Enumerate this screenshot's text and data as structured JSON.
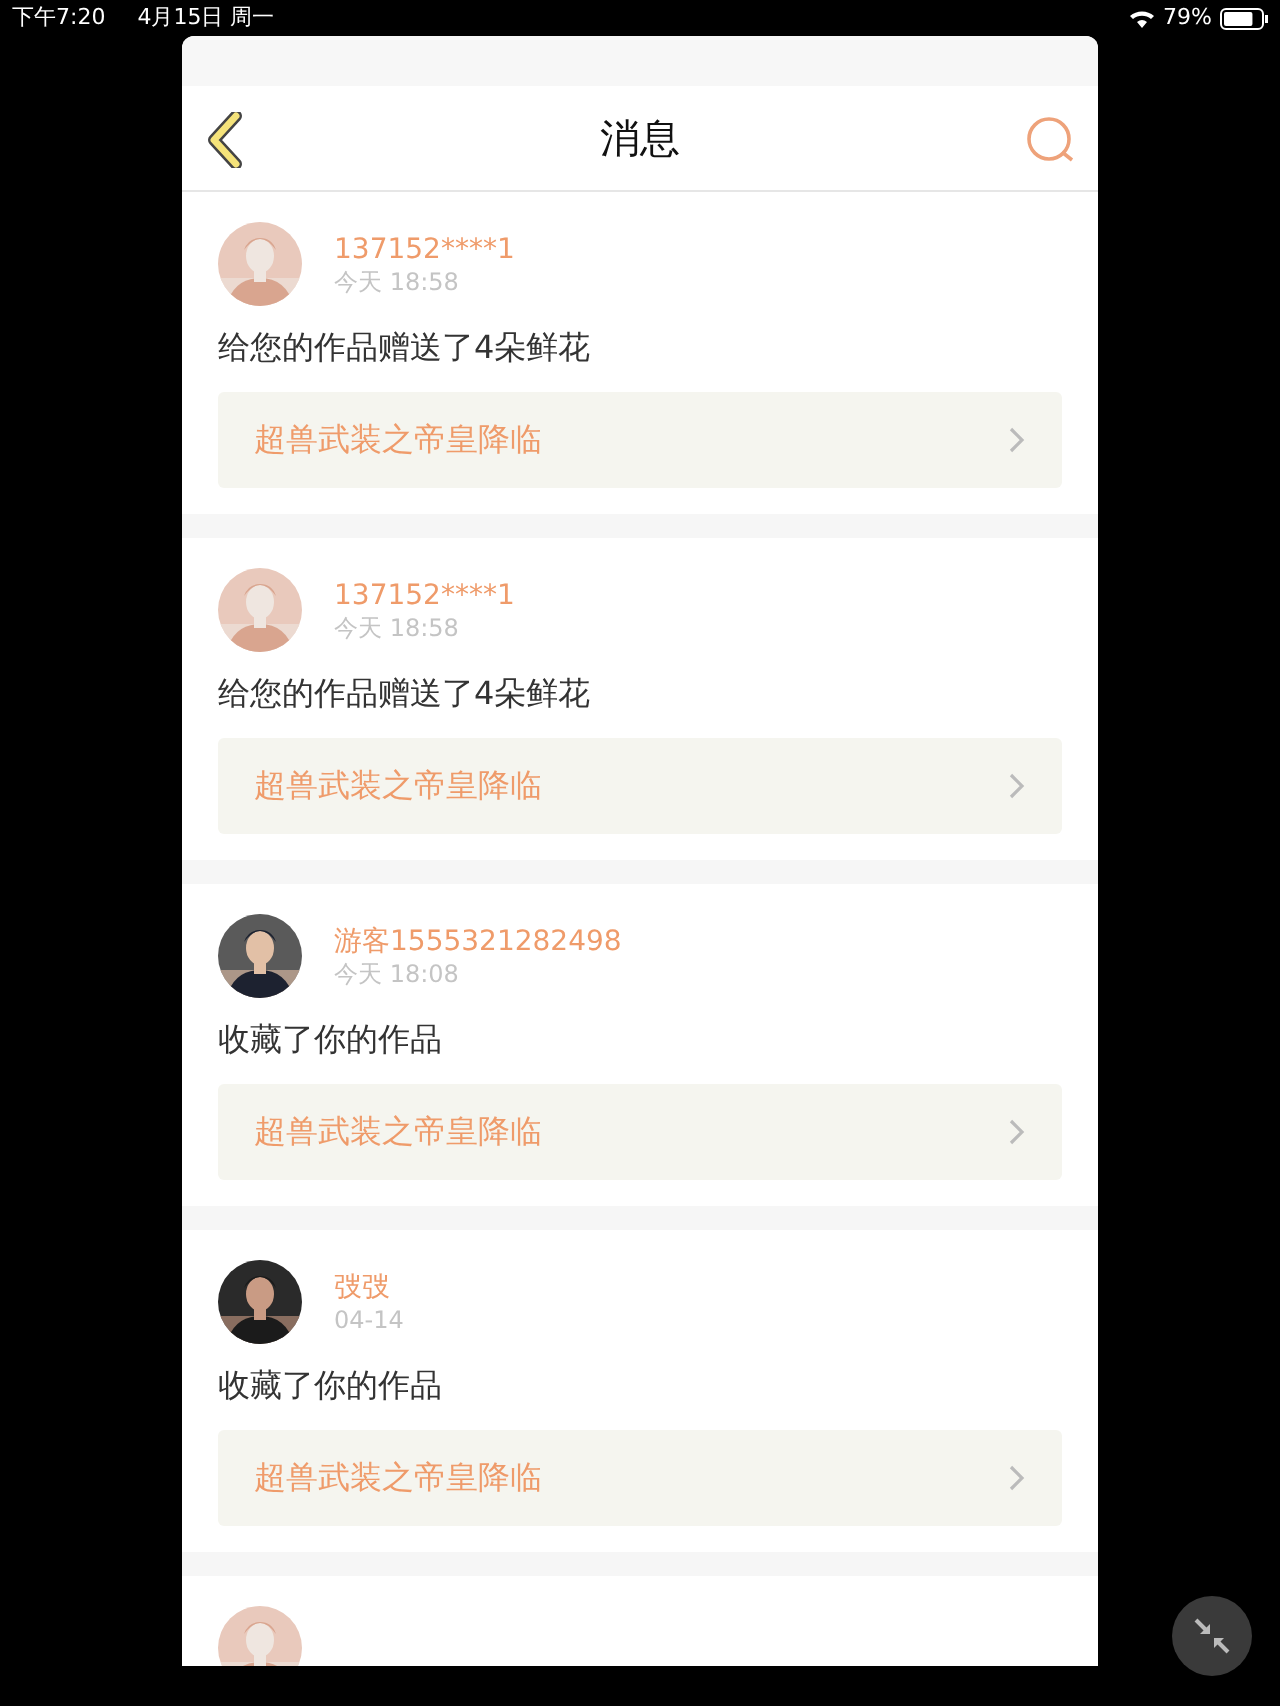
{
  "status_bar": {
    "time": "下午7:20",
    "date": "4月15日 周一",
    "battery": "79%"
  },
  "header": {
    "title": "消息"
  },
  "messages": [
    {
      "user": "137152****1",
      "time": "今天 18:58",
      "text": "给您的作品赠送了4朵鲜花",
      "link": "超兽武装之帝皇降临"
    },
    {
      "user": "137152****1",
      "time": "今天 18:58",
      "text": "给您的作品赠送了4朵鲜花",
      "link": "超兽武装之帝皇降临"
    },
    {
      "user": "游客1555321282498",
      "time": "今天 18:08",
      "text": "收藏了你的作品",
      "link": "超兽武装之帝皇降临"
    },
    {
      "user": "弢弢",
      "time": "04-14",
      "text": "收藏了你的作品",
      "link": "超兽武装之帝皇降临"
    }
  ]
}
